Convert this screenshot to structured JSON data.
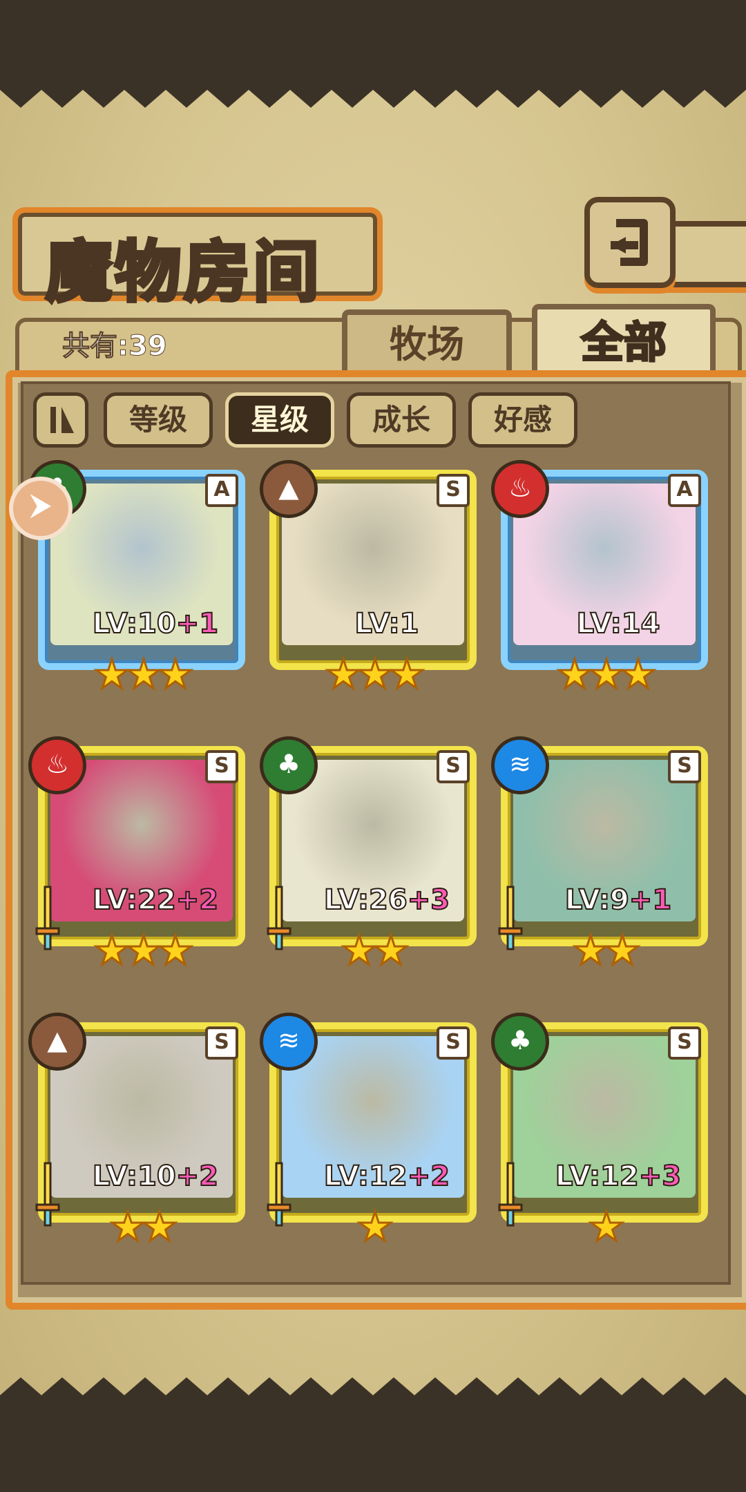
{
  "header": {
    "title": "魔物房间",
    "back_label": "返回"
  },
  "count": {
    "text": "共有:39"
  },
  "tabs": [
    {
      "label": "牧场",
      "active": false
    },
    {
      "label": "全部",
      "active": true
    }
  ],
  "sort": {
    "toggle_icon": "order-toggle-icon",
    "buttons": [
      {
        "label": "等级",
        "active": false
      },
      {
        "label": "星级",
        "active": true
      },
      {
        "label": "成长",
        "active": false
      },
      {
        "label": "好感",
        "active": false
      }
    ]
  },
  "cards": [
    {
      "rank": "A",
      "element": "leaf",
      "lv": "LV:10",
      "plus": "+1",
      "stars": "★★★",
      "portrait_color": "#dfe4c0",
      "pinned": true,
      "sword": false
    },
    {
      "rank": "S",
      "element": "earth",
      "lv": "LV:1",
      "plus": "",
      "stars": "★★★",
      "portrait_color": "#e7ddc2",
      "pinned": false,
      "sword": false
    },
    {
      "rank": "A",
      "element": "fire",
      "lv": "LV:14",
      "plus": "",
      "stars": "★★★",
      "portrait_color": "#f3d3e6",
      "pinned": false,
      "sword": false
    },
    {
      "rank": "S",
      "element": "fire",
      "lv": "LV:22",
      "plus": "+2",
      "stars": "★★★",
      "portrait_color": "#d64c77",
      "pinned": false,
      "sword": true
    },
    {
      "rank": "S",
      "element": "leaf",
      "lv": "LV:26",
      "plus": "+3",
      "stars": "★★",
      "portrait_color": "#e9e6cf",
      "pinned": false,
      "sword": true
    },
    {
      "rank": "S",
      "element": "water",
      "lv": "LV:9",
      "plus": "+1",
      "stars": "★★",
      "portrait_color": "#8fbfaa",
      "pinned": false,
      "sword": true
    },
    {
      "rank": "S",
      "element": "earth",
      "lv": "LV:10",
      "plus": "+2",
      "stars": "★★",
      "portrait_color": "#cfcac0",
      "pinned": false,
      "sword": true
    },
    {
      "rank": "S",
      "element": "water",
      "lv": "LV:12",
      "plus": "+2",
      "stars": "★",
      "portrait_color": "#a9d3f2",
      "pinned": false,
      "sword": true
    },
    {
      "rank": "S",
      "element": "leaf",
      "lv": "LV:12",
      "plus": "+3",
      "stars": "★",
      "portrait_color": "#9fd19a",
      "pinned": false,
      "sword": true
    }
  ],
  "element_colors": {
    "leaf": "#2e7d32",
    "earth": "#8b5a3c",
    "fire": "#d32f2f",
    "water": "#1e88e5"
  },
  "element_glyphs": {
    "leaf": "♣",
    "earth": "▲",
    "fire": "♨",
    "water": "≋"
  },
  "pin_glyph": "⮞"
}
